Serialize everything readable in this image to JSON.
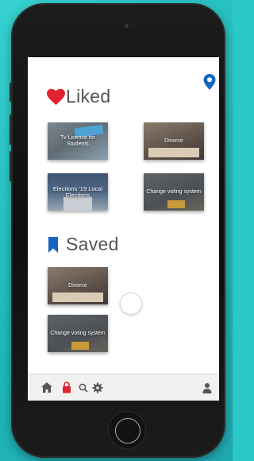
{
  "liked": {
    "title": "Liked",
    "cards": [
      {
        "caption": "Tv Licence for Students"
      },
      {
        "caption": "Divorce"
      },
      {
        "caption": "Elections '19 Local Elections"
      },
      {
        "caption": "Change voting system"
      }
    ]
  },
  "saved": {
    "title": "Saved",
    "cards": [
      {
        "caption": "Divorce"
      },
      {
        "caption": "Change voting system"
      }
    ]
  },
  "colors": {
    "heart": "#e0232f",
    "bookmark": "#1565c0",
    "location": "#1565c0",
    "lock": "#e0232f"
  },
  "icons": {
    "top_right": "location-pin-icon",
    "bottom_bar": [
      "home-icon",
      "lock-icon",
      "search-icon",
      "settings-icon",
      "user-icon"
    ]
  }
}
